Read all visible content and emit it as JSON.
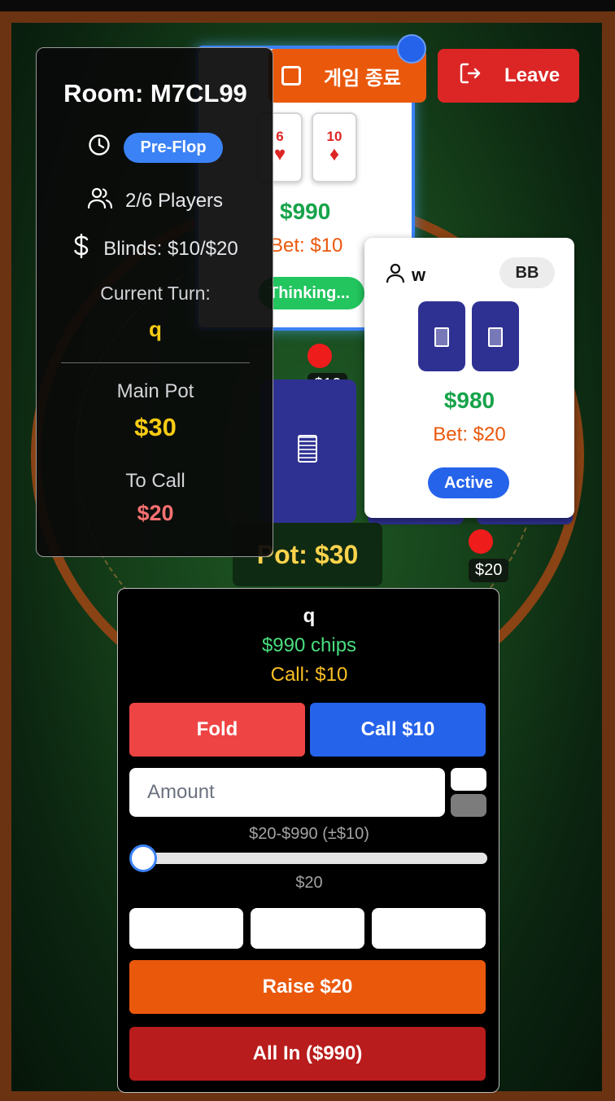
{
  "top_controls": {
    "end_game_label": "게임 종료",
    "leave_label": "Leave"
  },
  "room": {
    "title": "Room: M7CL99",
    "phase": "Pre-Flop",
    "players": "2/6 Players",
    "blinds": "Blinds: $10/$20",
    "current_turn_label": "Current Turn:",
    "current_turn_value": "q",
    "main_pot_label": "Main Pot",
    "main_pot_value": "$30",
    "to_call_label": "To Call",
    "to_call_value": "$20"
  },
  "player_top": {
    "cards": [
      {
        "rank": "6",
        "suit": "♥"
      },
      {
        "rank": "10",
        "suit": "♦"
      }
    ],
    "chips": "$990",
    "bet": "Bet: $10",
    "status": "Thinking...",
    "chip_bet": "$10"
  },
  "player_w": {
    "name": "w",
    "position_badge": "BB",
    "chips": "$980",
    "bet": "Bet: $20",
    "status": "Active",
    "chip_bet": "$20"
  },
  "table": {
    "pot": "Pot: $30"
  },
  "action": {
    "player_name": "q",
    "chips": "$990 chips",
    "call_info": "Call: $10",
    "fold_label": "Fold",
    "call_label": "Call $10",
    "amount_placeholder": "Amount",
    "range": "$20-$990 (±$10)",
    "slider_value": "$20",
    "slider_fraction": 0.0,
    "raise_label": "Raise $20",
    "all_in_label": "All In ($990)"
  },
  "colors": {
    "phase_badge": "#3b82f6",
    "fold": "#ef4444",
    "call": "#2563eb",
    "raise": "#ea580c",
    "all_in": "#b91c1c",
    "leave": "#dc2626",
    "end_game": "#ea580c"
  },
  "icons": {
    "end_game": "square-icon",
    "leave": "logout-icon",
    "phase": "clock-icon",
    "players": "users-icon",
    "blinds": "dollar-icon",
    "player_w": "user-icon"
  }
}
